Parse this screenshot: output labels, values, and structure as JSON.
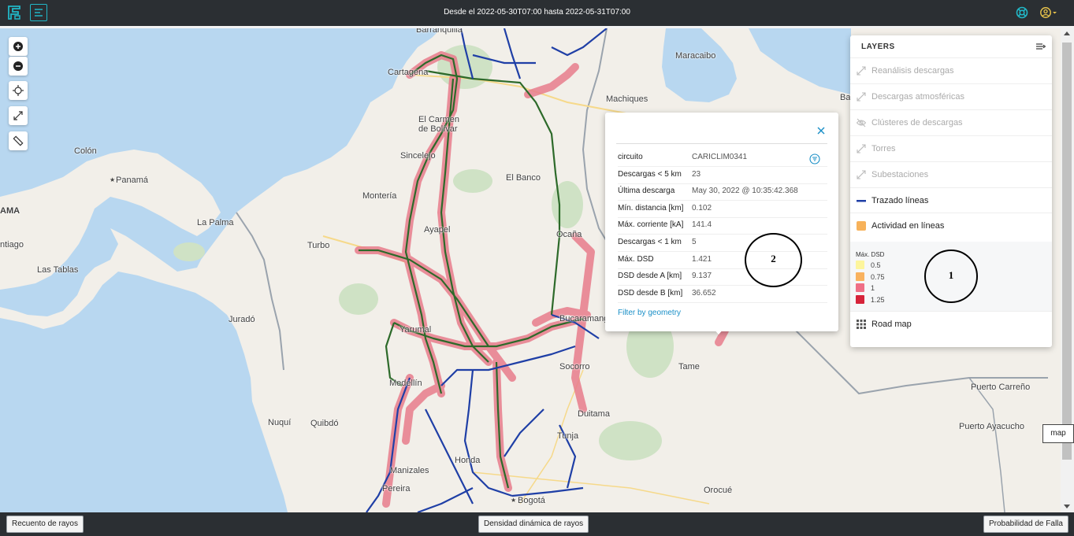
{
  "header": {
    "title": "Desde el 2022-05-30T07:00 hasta 2022-05-31T07:00"
  },
  "map_labels": [
    {
      "id": "barranquilla",
      "text": "Barranquilla"
    },
    {
      "id": "cartagena",
      "text": "Cartagena"
    },
    {
      "id": "maracaibo",
      "text": "Maracaibo"
    },
    {
      "id": "machiques",
      "text": "Machiques"
    },
    {
      "id": "el-carmen",
      "text": "El Carmen"
    },
    {
      "id": "de-bolivar",
      "text": "de Bolívar"
    },
    {
      "id": "colon",
      "text": "Colón"
    },
    {
      "id": "panama",
      "text": "Panamá"
    },
    {
      "id": "ama",
      "text": "AMA"
    },
    {
      "id": "sincelejo",
      "text": "Sincelejo"
    },
    {
      "id": "el-banco",
      "text": "El Banco"
    },
    {
      "id": "monteria",
      "text": "Montería"
    },
    {
      "id": "la-palma",
      "text": "La Palma"
    },
    {
      "id": "ayapel",
      "text": "Ayapel"
    },
    {
      "id": "ocana",
      "text": "Ocaña"
    },
    {
      "id": "ntiago",
      "text": "ntiago"
    },
    {
      "id": "turbo",
      "text": "Turbo"
    },
    {
      "id": "las-tablas",
      "text": "Las Tablas"
    },
    {
      "id": "jurado",
      "text": "Juradó"
    },
    {
      "id": "yarumal",
      "text": "Yarumal"
    },
    {
      "id": "bucaramanga",
      "text": "Bucaramanga"
    },
    {
      "id": "socorro",
      "text": "Socorro"
    },
    {
      "id": "tame",
      "text": "Tame"
    },
    {
      "id": "medellin",
      "text": "Medellín"
    },
    {
      "id": "puerto-carreno",
      "text": "Puerto Carreño"
    },
    {
      "id": "duitama",
      "text": "Duitama"
    },
    {
      "id": "nuqui",
      "text": "Nuquí"
    },
    {
      "id": "quibdo",
      "text": "Quibdó"
    },
    {
      "id": "tunja",
      "text": "Tunja"
    },
    {
      "id": "puerto-ayacucho",
      "text": "Puerto Ayacucho"
    },
    {
      "id": "honda",
      "text": "Honda"
    },
    {
      "id": "manizales",
      "text": "Manizales"
    },
    {
      "id": "pereira",
      "text": "Pereira"
    },
    {
      "id": "bogota",
      "text": "Bogotá"
    },
    {
      "id": "orocue",
      "text": "Orocué"
    },
    {
      "id": "ba",
      "text": "Ba"
    }
  ],
  "popup": {
    "rows": [
      {
        "key": "circuito",
        "value": "CARICLIM0341"
      },
      {
        "key": "Descargas < 5 km",
        "value": "23"
      },
      {
        "key": "Última descarga",
        "value": "May 30, 2022 @ 10:35:42.368"
      },
      {
        "key": "Mín. distancia [km]",
        "value": "0.102"
      },
      {
        "key": "Máx. corriente [kA]",
        "value": "141.4"
      },
      {
        "key": "Descargas < 1 km",
        "value": "5"
      },
      {
        "key": "Máx. DSD",
        "value": "1.421"
      },
      {
        "key": "DSD desde A [km]",
        "value": "9.137"
      },
      {
        "key": "DSD desde B [km]",
        "value": "36.652"
      }
    ],
    "link": "Filter by geometry"
  },
  "layers": {
    "header": "LAYERS",
    "items": [
      {
        "label": "Reanálisis descargas",
        "state": "disabled",
        "icon": "resize-icon"
      },
      {
        "label": "Descargas atmosféricas",
        "state": "disabled",
        "icon": "resize-icon"
      },
      {
        "label": "Clústeres de descargas",
        "state": "disabled",
        "icon": "eye-slash-icon"
      },
      {
        "label": "Torres",
        "state": "disabled",
        "icon": "resize-icon"
      },
      {
        "label": "Subestaciones",
        "state": "disabled",
        "icon": "resize-icon"
      },
      {
        "label": "Trazado líneas",
        "state": "enabled",
        "icon": "line-swatch-icon",
        "color": "#1f3fa6"
      },
      {
        "label": "Actividad en líneas",
        "state": "enabled",
        "icon": "square-swatch-icon",
        "color": "#f7b25a"
      }
    ],
    "legend": {
      "title": "Máx. DSD",
      "entries": [
        {
          "label": "0.5",
          "color": "#fdf59c"
        },
        {
          "label": "0.75",
          "color": "#f9b25f"
        },
        {
          "label": "1",
          "color": "#ef6f86"
        },
        {
          "label": "1.25",
          "color": "#d6233a"
        }
      ]
    },
    "basemap": {
      "label": "Road map",
      "icon": "grid-icon"
    }
  },
  "annotations": [
    {
      "label": "1"
    },
    {
      "label": "2"
    }
  ],
  "tooltip": "map",
  "footer": {
    "left": "Recuento de rayos",
    "center": "Densidad dinámica de rayos",
    "right": "Probabilidad de Falla"
  },
  "colors": {
    "topbar": "#2b2f33",
    "accent": "#21b7c7",
    "sea": "#b8d7f0",
    "land": "#f2efe9",
    "line_blue": "#1f3fa6",
    "line_green": "#2d6a2a",
    "activity_red": "#e85d75"
  }
}
